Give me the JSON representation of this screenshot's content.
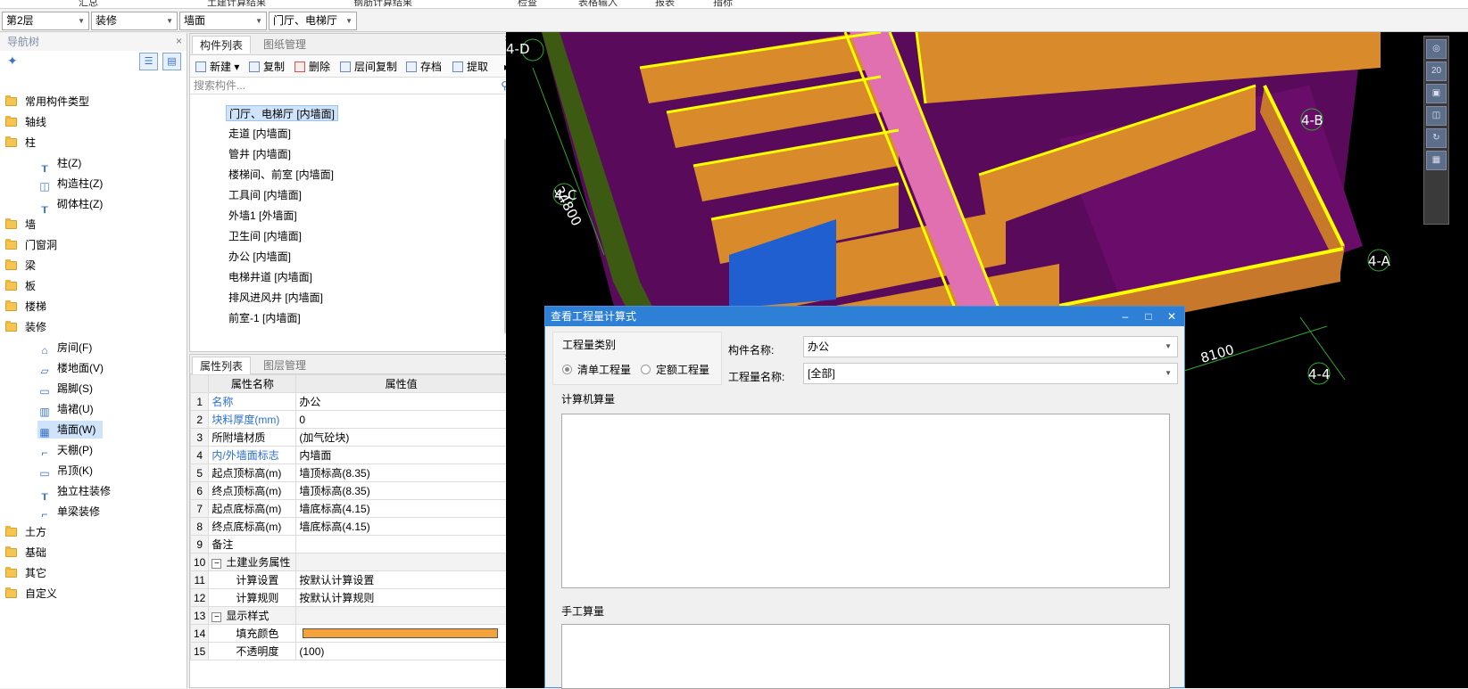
{
  "top_menu": [
    "汇总",
    "土建计算结果",
    "钢筋计算结果",
    "检查",
    "表格输入",
    "报表",
    "指标"
  ],
  "selectors": [
    {
      "value": "第2层"
    },
    {
      "value": "装修"
    },
    {
      "value": "墙面"
    },
    {
      "value": "门厅、电梯厅"
    }
  ],
  "nav": {
    "title": "导航树",
    "items": [
      {
        "label": "常用构件类型",
        "level": 0
      },
      {
        "label": "轴线",
        "level": 0
      },
      {
        "label": "柱",
        "level": 0
      },
      {
        "label": "柱(Z)",
        "level": 1
      },
      {
        "label": "构造柱(Z)",
        "level": 1
      },
      {
        "label": "砌体柱(Z)",
        "level": 1
      },
      {
        "label": "墙",
        "level": 0
      },
      {
        "label": "门窗洞",
        "level": 0
      },
      {
        "label": "梁",
        "level": 0
      },
      {
        "label": "板",
        "level": 0
      },
      {
        "label": "楼梯",
        "level": 0
      },
      {
        "label": "装修",
        "level": 0
      },
      {
        "label": "房间(F)",
        "level": 1
      },
      {
        "label": "楼地面(V)",
        "level": 1
      },
      {
        "label": "踢脚(S)",
        "level": 1
      },
      {
        "label": "墙裙(U)",
        "level": 1
      },
      {
        "label": "墙面(W)",
        "level": 1,
        "selected": true
      },
      {
        "label": "天棚(P)",
        "level": 1
      },
      {
        "label": "吊顶(K)",
        "level": 1
      },
      {
        "label": "独立柱装修",
        "level": 1
      },
      {
        "label": "单梁装修",
        "level": 1
      },
      {
        "label": "土方",
        "level": 0
      },
      {
        "label": "基础",
        "level": 0
      },
      {
        "label": "其它",
        "level": 0
      },
      {
        "label": "自定义",
        "level": 0
      }
    ]
  },
  "components": {
    "tabs": [
      "构件列表",
      "图纸管理"
    ],
    "toolbar": [
      "新建",
      "复制",
      "删除",
      "层间复制",
      "存档",
      "提取"
    ],
    "search_placeholder": "搜索构件...",
    "items": [
      {
        "label": "门厅、电梯厅 [内墙面]",
        "selected": true
      },
      {
        "label": "走道 [内墙面]"
      },
      {
        "label": "管井 [内墙面]"
      },
      {
        "label": "楼梯间、前室 [内墙面]"
      },
      {
        "label": "工具间 [内墙面]"
      },
      {
        "label": "外墙1 [外墙面]"
      },
      {
        "label": "卫生间 [内墙面]"
      },
      {
        "label": "办公 [内墙面]"
      },
      {
        "label": "电梯井道 [内墙面]"
      },
      {
        "label": "排风进风井 [内墙面]"
      },
      {
        "label": "前室-1 [内墙面]"
      }
    ]
  },
  "properties": {
    "tabs": [
      "属性列表",
      "图层管理"
    ],
    "headers": [
      "属性名称",
      "属性值"
    ],
    "rows": [
      {
        "n": "1",
        "name": "名称",
        "value": "办公",
        "blue": true
      },
      {
        "n": "2",
        "name": "块料厚度(mm)",
        "value": "0",
        "blue": true
      },
      {
        "n": "3",
        "name": "所附墙材质",
        "value": "(加气砼块)"
      },
      {
        "n": "4",
        "name": "内/外墙面标志",
        "value": "内墙面",
        "blue": true
      },
      {
        "n": "5",
        "name": "起点顶标高(m)",
        "value": "墙顶标高(8.35)"
      },
      {
        "n": "6",
        "name": "终点顶标高(m)",
        "value": "墙顶标高(8.35)"
      },
      {
        "n": "7",
        "name": "起点底标高(m)",
        "value": "墙底标高(4.15)"
      },
      {
        "n": "8",
        "name": "终点底标高(m)",
        "value": "墙底标高(4.15)"
      },
      {
        "n": "9",
        "name": "备注",
        "value": ""
      },
      {
        "n": "10",
        "name": "土建业务属性",
        "value": "",
        "group": true
      },
      {
        "n": "11",
        "name": "计算设置",
        "value": "按默认计算设置",
        "child": true
      },
      {
        "n": "12",
        "name": "计算规则",
        "value": "按默认计算规则",
        "child": true
      },
      {
        "n": "13",
        "name": "显示样式",
        "value": "",
        "group": true
      },
      {
        "n": "14",
        "name": "填充颜色",
        "value": "",
        "child": true,
        "color": true
      },
      {
        "n": "15",
        "name": "不透明度",
        "value": "(100)",
        "child": true
      }
    ],
    "fill_color": "#f4a23c"
  },
  "cad": {
    "axis_labels": [
      "4-D",
      "4-B",
      "4-C",
      "4-A",
      "4-4"
    ],
    "dims": [
      "34800",
      "8100"
    ],
    "wall_color": "#d98a2b",
    "floor_color": "#5a0a5a",
    "edge_color": "#ffff00",
    "corridor_color": "#e070b0",
    "blue_wall_color": "#1f5fd0"
  },
  "dialog": {
    "title": "查看工程量计算式",
    "category_label": "工程量类别",
    "radio1": "清单工程量",
    "radio2": "定额工程量",
    "component_name_label": "构件名称:",
    "component_name_value": "办公",
    "quantity_name_label": "工程量名称:",
    "quantity_name_value": "[全部]",
    "computer_label": "计算机算量",
    "manual_label": "手工算量"
  }
}
